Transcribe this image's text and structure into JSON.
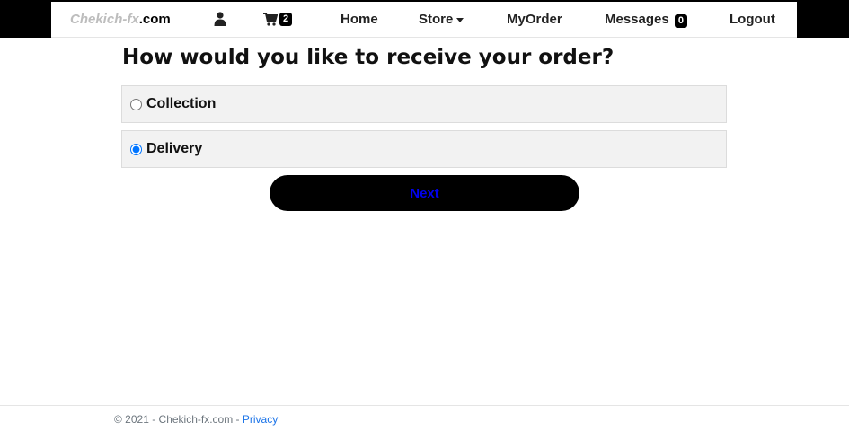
{
  "nav": {
    "brand_part1": "Chekich-fx",
    "brand_part2": ".com",
    "user_icon": "user-icon",
    "cart_icon": "shopping-cart-icon",
    "cart_count": "2",
    "home": "Home",
    "store": "Store",
    "myorder": "MyOrder",
    "messages": "Messages",
    "messages_count": "0",
    "logout": "Logout"
  },
  "page": {
    "title": "How would you like to receive your order?",
    "options": [
      {
        "label": "Collection",
        "selected": false
      },
      {
        "label": "Delivery",
        "selected": true
      }
    ],
    "next_label": "Next"
  },
  "footer": {
    "text": "© 2021 - Chekich-fx.com - ",
    "privacy": "Privacy"
  },
  "colors": {
    "topbar": "#000000",
    "button_bg": "#000000",
    "button_text": "#0000ee",
    "link": "#1a73e8"
  }
}
